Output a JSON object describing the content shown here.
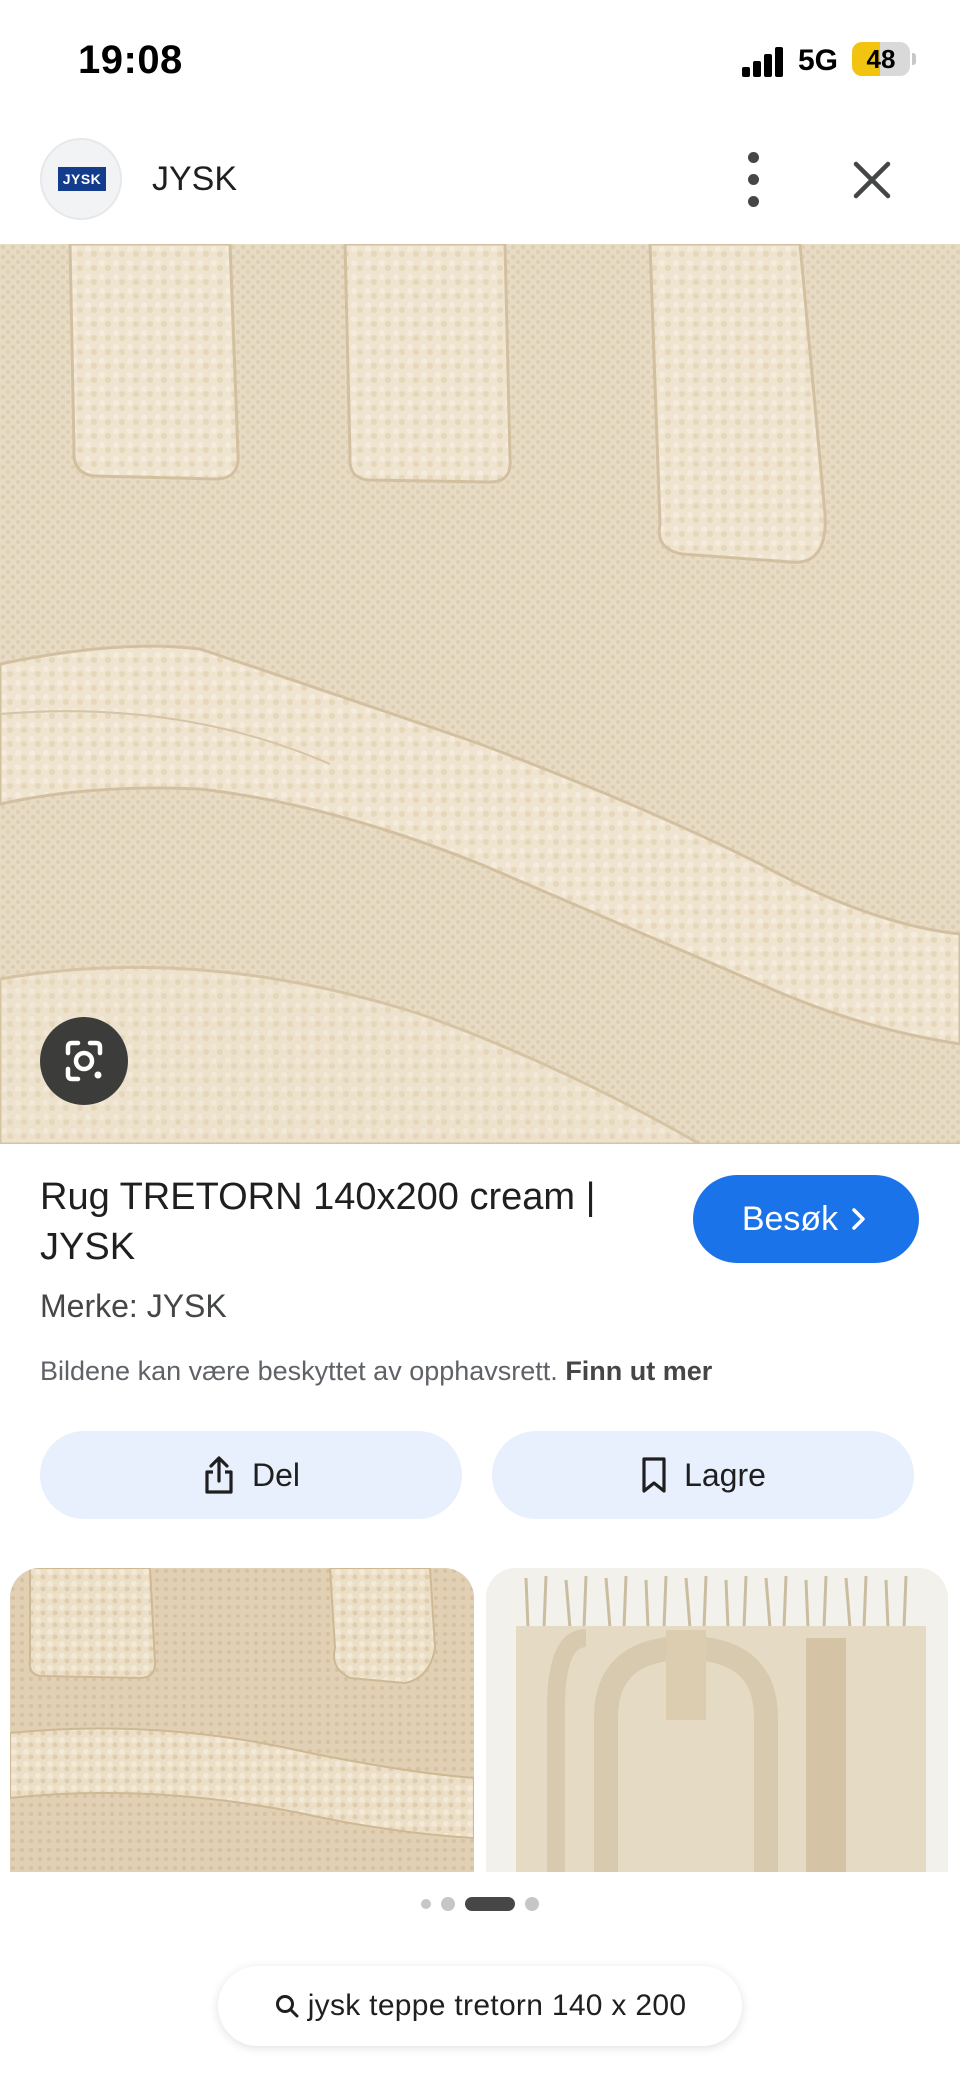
{
  "status_bar": {
    "time": "19:08",
    "network": "5G",
    "battery": "48",
    "battery_level": 0.48,
    "battery_color": "#f2c410"
  },
  "header": {
    "site_logo_text": "JYSK",
    "site_name": "JYSK",
    "more_icon": "more-vert-icon",
    "close_icon": "close-icon"
  },
  "image": {
    "subject": "cream rug texture close-up",
    "lens_icon": "google-lens-icon"
  },
  "result": {
    "title": "Rug TRETORN 140x200 cream | JYSK",
    "visit_label": "Besøk",
    "visit_icon": "chevron-right-icon",
    "visit_color": "#1a73e8",
    "brand": "Merke: JYSK",
    "copyright_text": "Bildene kan være beskyttet av opphavsrett.",
    "learn_more": "Finn ut mer"
  },
  "actions": {
    "share_label": "Del",
    "share_icon": "share-icon",
    "save_label": "Lagre",
    "save_icon": "bookmark-icon",
    "pill_color": "#e8effd"
  },
  "related": {
    "count_shown": 2
  },
  "pager": {
    "total": 4,
    "active_index": 2
  },
  "search": {
    "icon": "search-icon",
    "query": "jysk teppe tretorn 140 x 200"
  }
}
